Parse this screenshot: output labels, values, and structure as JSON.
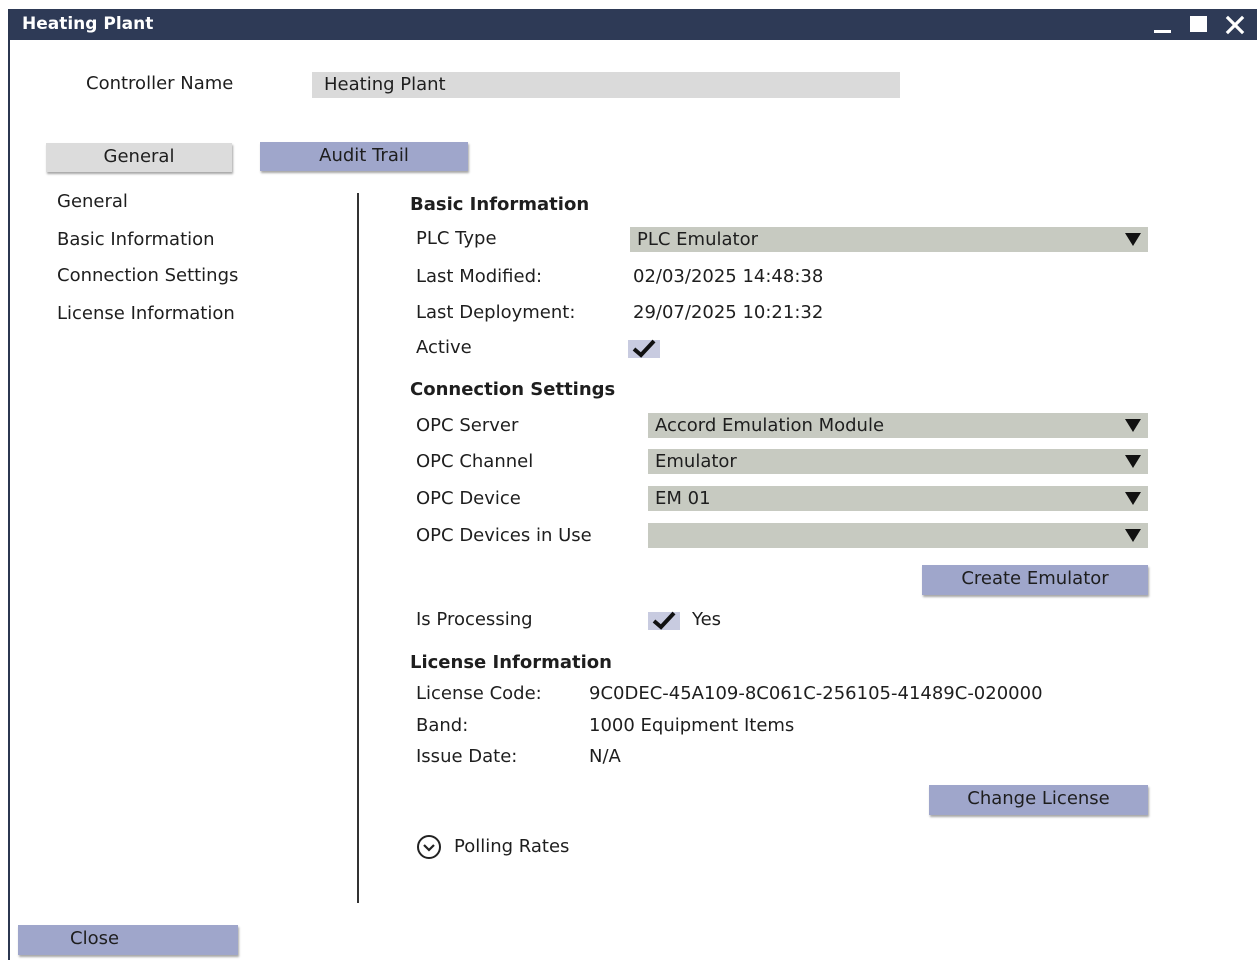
{
  "window": {
    "title": "Heating Plant"
  },
  "controller": {
    "label": "Controller Name",
    "value": "Heating Plant"
  },
  "tabs": [
    {
      "label": "General"
    },
    {
      "label": "Audit Trail"
    }
  ],
  "nav": [
    {
      "label": "General"
    },
    {
      "label": "Basic Information"
    },
    {
      "label": "Connection Settings"
    },
    {
      "label": "License Information"
    }
  ],
  "basic": {
    "heading": "Basic Information",
    "plc_type_label": "PLC Type",
    "plc_type_value": "PLC Emulator",
    "last_modified_label": "Last Modified:",
    "last_modified_value": "02/03/2025 14:48:38",
    "last_deployment_label": "Last Deployment:",
    "last_deployment_value": "29/07/2025 10:21:32",
    "active_label": "Active",
    "active_checked": true
  },
  "connection": {
    "heading": "Connection Settings",
    "opc_server_label": "OPC Server",
    "opc_server_value": "Accord Emulation Module",
    "opc_channel_label": "OPC Channel",
    "opc_channel_value": "Emulator",
    "opc_device_label": "OPC Device",
    "opc_device_value": "EM 01",
    "opc_devices_in_use_label": "OPC Devices in Use",
    "opc_devices_in_use_value": "",
    "create_emulator_label": "Create Emulator",
    "is_processing_label": "Is Processing",
    "is_processing_checked": true,
    "is_processing_value": "Yes"
  },
  "license": {
    "heading": "License Information",
    "code_label": "License Code:",
    "code_value": "9C0DEC-45A109-8C061C-256105-41489C-020000",
    "band_label": "Band:",
    "band_value": "1000 Equipment Items",
    "issue_date_label": "Issue Date:",
    "issue_date_value": "N/A",
    "change_license_label": "Change License"
  },
  "polling": {
    "label": "Polling Rates"
  },
  "footer": {
    "close_label": "Close"
  },
  "colors": {
    "titlebar": "#2e3a56",
    "button_accent": "#9fa6cb",
    "select_bg": "#c7cac1",
    "field_bg": "#dadada"
  }
}
